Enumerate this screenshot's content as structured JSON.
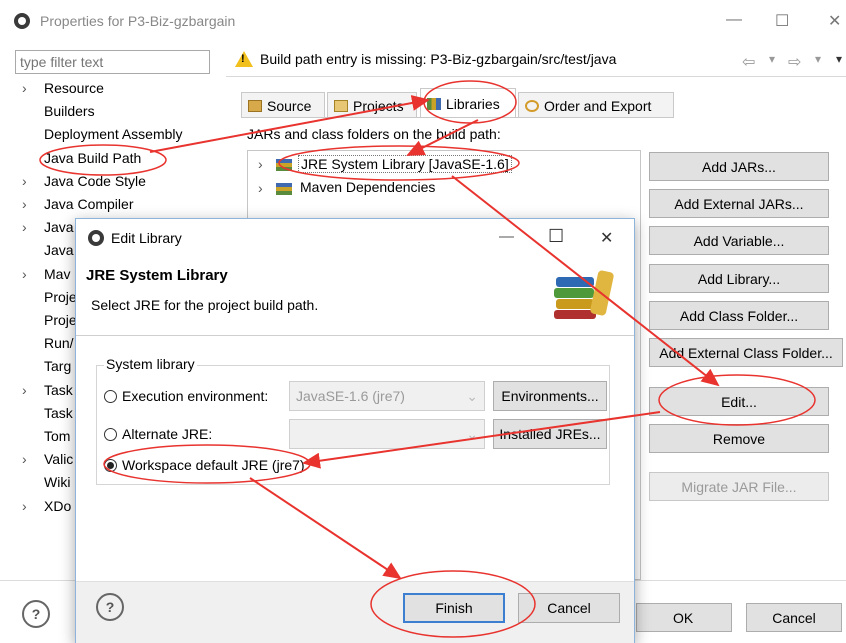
{
  "window": {
    "title": "Properties for P3-Biz-gzbargain",
    "min": "—",
    "max": "☐",
    "close": "✕"
  },
  "filter": {
    "placeholder": "type filter text"
  },
  "left_tree": [
    {
      "label": "Resource",
      "arrow": true
    },
    {
      "label": "Builders",
      "arrow": false
    },
    {
      "label": "Deployment Assembly",
      "arrow": false
    },
    {
      "label": "Java Build Path",
      "arrow": false
    },
    {
      "label": "Java Code Style",
      "arrow": true
    },
    {
      "label": "Java Compiler",
      "arrow": true
    },
    {
      "label": "Java",
      "arrow": true
    },
    {
      "label": "Java",
      "arrow": false
    },
    {
      "label": "Mav",
      "arrow": true
    },
    {
      "label": "Proje",
      "arrow": false
    },
    {
      "label": "Proje",
      "arrow": false
    },
    {
      "label": "Run/",
      "arrow": false
    },
    {
      "label": "Targ",
      "arrow": false
    },
    {
      "label": "Task",
      "arrow": true
    },
    {
      "label": "Task",
      "arrow": false
    },
    {
      "label": "Tom",
      "arrow": false
    },
    {
      "label": "Valic",
      "arrow": true
    },
    {
      "label": "Wiki",
      "arrow": false
    },
    {
      "label": "XDo",
      "arrow": true
    }
  ],
  "header": {
    "warning": "Build path entry is missing: P3-Biz-gzbargain/src/test/java",
    "nav_back": "⇦",
    "nav_fwd": "⇨",
    "nav_menu": "▾"
  },
  "tabs": [
    "Source",
    "Projects",
    "Libraries",
    "Order and Export"
  ],
  "jars_label": "JARs and class folders on the build path:",
  "libraries": [
    "JRE System Library [JavaSE-1.6]",
    "Maven Dependencies"
  ],
  "side_buttons": [
    "Add JARs...",
    "Add External JARs...",
    "Add Variable...",
    "Add Library...",
    "Add Class Folder...",
    "Add External Class Folder...",
    "Edit...",
    "Remove",
    "Migrate JAR File..."
  ],
  "main_buttons": {
    "ok": "OK",
    "cancel": "Cancel",
    "help": "?"
  },
  "dialog": {
    "title": "Edit Library",
    "min": "—",
    "max": "☐",
    "close": "✕",
    "heading": "JRE System Library",
    "subtitle": "Select JRE for the project build path.",
    "group": "System library",
    "opt_exec": "Execution environment:",
    "exec_value": "JavaSE-1.6 (jre7)",
    "environments": "Environments...",
    "opt_alt": "Alternate JRE:",
    "installed": "Installed JREs...",
    "opt_ws": "Workspace default JRE (jre7)",
    "finish": "Finish",
    "cancel": "Cancel",
    "help": "?"
  },
  "colors": {
    "annotation": "#e8332e",
    "active_border": "#7eb4ea"
  }
}
